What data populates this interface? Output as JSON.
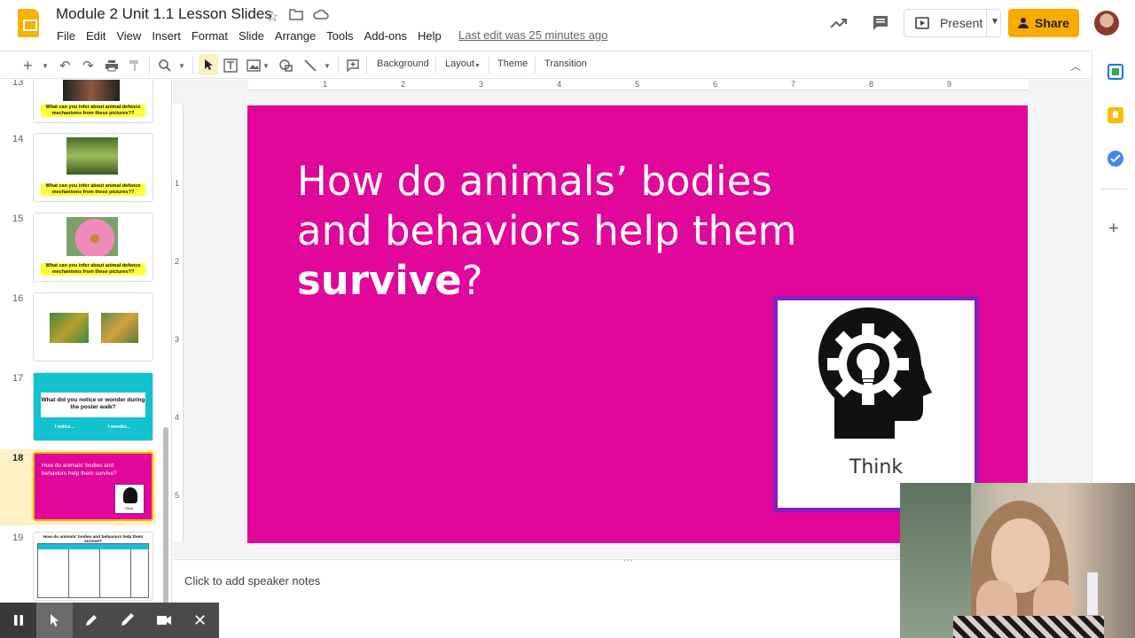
{
  "header": {
    "title": "Module 2 Unit 1.1 Lesson Slides",
    "menu": [
      "File",
      "Edit",
      "View",
      "Insert",
      "Format",
      "Slide",
      "Arrange",
      "Tools",
      "Add-ons",
      "Help"
    ],
    "last_edit": "Last edit was 25 minutes ago",
    "present_label": "Present",
    "share_label": "Share"
  },
  "toolbar": {
    "background_label": "Background",
    "layout_label": "Layout",
    "theme_label": "Theme",
    "transition_label": "Transition"
  },
  "filmstrip": {
    "slides": [
      {
        "num": "13",
        "caption": "What can you infer about animal defence mechanisms from these pictures??"
      },
      {
        "num": "14",
        "caption": "What can you infer about animal defence mechanisms from these pictures??"
      },
      {
        "num": "15",
        "caption": "What can you infer about animal defence mechanisms from these pictures??"
      },
      {
        "num": "16",
        "caption": ""
      },
      {
        "num": "17",
        "caption": "What did you notice or wonder during the poster walk?",
        "notice": "I notice...",
        "wonder": "I wonder..."
      },
      {
        "num": "18",
        "caption": "How do animals' bodies and behaviors help them survive?",
        "think": "Think"
      },
      {
        "num": "19",
        "caption": "How do animals' bodies and behaviors help them survive?"
      }
    ]
  },
  "ruler": {
    "top": [
      "1",
      "2",
      "3",
      "4",
      "5",
      "6",
      "7",
      "8",
      "9"
    ],
    "left": [
      "1",
      "2",
      "3",
      "4",
      "5"
    ]
  },
  "slide": {
    "title_line1": "How do animals’ bodies",
    "title_line2": "and behaviors help them",
    "title_bold": "survive",
    "title_end": "?",
    "card_label": "Think",
    "bg_color": "#e0079a",
    "card_border_color": "#8a1dbf"
  },
  "notes": {
    "placeholder": "Click to add speaker notes"
  },
  "colors": {
    "share": "#f9ab00",
    "selected_slide": "#fdf1c4",
    "thumb17_bg": "#13c1cf"
  }
}
